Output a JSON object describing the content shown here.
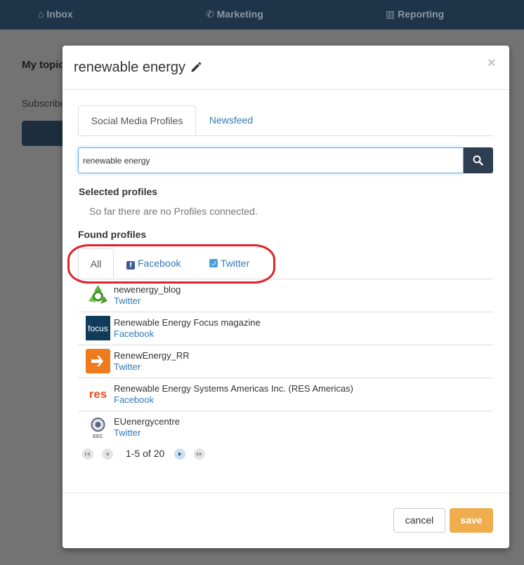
{
  "topnav": {
    "items": [
      {
        "label": "Inbox",
        "icon": "home-icon"
      },
      {
        "label": "Marketing",
        "icon": "megaphone-icon"
      },
      {
        "label": "Reporting",
        "icon": "bar-chart-icon"
      }
    ]
  },
  "background": {
    "title": "My topic",
    "subtitle": "Subscribe"
  },
  "modal": {
    "title": "renewable energy",
    "close": "×",
    "tabs": [
      "Social Media Profiles",
      "Newsfeed"
    ],
    "search": {
      "value": "renewable energy"
    },
    "selected_title": "Selected profiles",
    "selected_empty": "So far there are no Profiles connected.",
    "found_title": "Found profiles",
    "found_tabs": [
      "All",
      "Facebook",
      "Twitter"
    ],
    "results": [
      {
        "name": "newenergy_blog",
        "network": "Twitter"
      },
      {
        "name": "Renewable Energy Focus magazine",
        "network": "Facebook"
      },
      {
        "name": "RenewEnergy_RR",
        "network": "Twitter"
      },
      {
        "name": "Renewable Energy Systems Americas Inc. (RES Americas)",
        "network": "Facebook"
      },
      {
        "name": "EUenergycentre",
        "network": "Twitter"
      }
    ],
    "avatar_text": {
      "focus": "focus",
      "res": "res",
      "eec": "EEC"
    },
    "pager": "1-5 of 20",
    "cancel_label": "cancel",
    "save_label": "save"
  },
  "colors": {
    "nav": "#1e3448",
    "accent": "#337ab7",
    "save": "#f0ad4e",
    "highlight_ellipse": "#e0232b",
    "facebook": "#3b5998",
    "twitter": "#4aa0d8"
  }
}
